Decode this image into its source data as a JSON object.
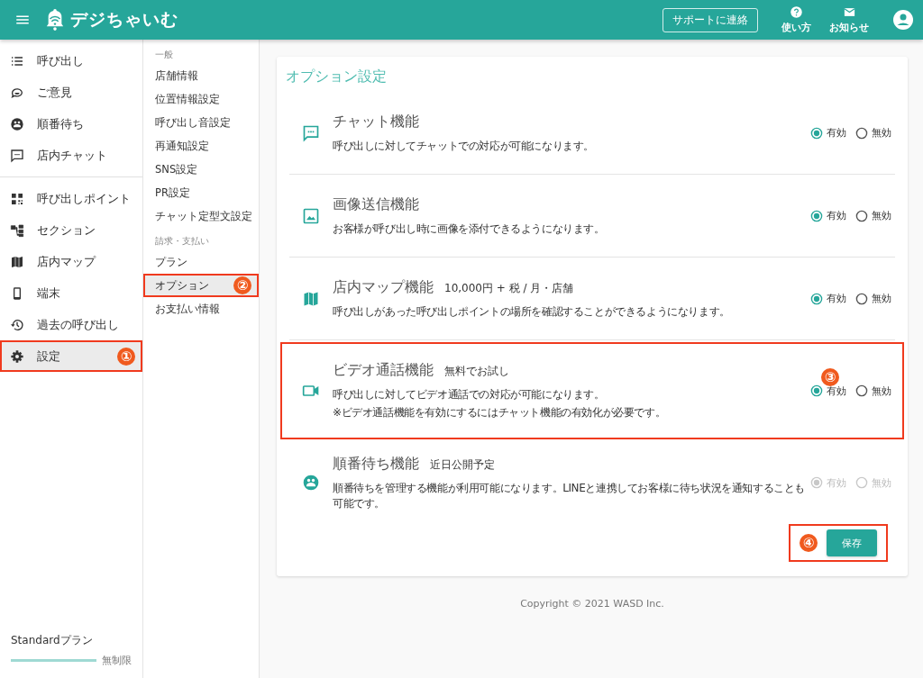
{
  "header": {
    "logo": "デジちゃいむ",
    "support_button": "サポートに連絡",
    "help": "使い方",
    "notices": "お知らせ"
  },
  "nav": {
    "groups": [
      [
        {
          "label": "呼び出し",
          "selected": false
        },
        {
          "label": "ご意見",
          "selected": false
        },
        {
          "label": "順番待ち",
          "selected": false
        },
        {
          "label": "店内チャット",
          "selected": false
        }
      ],
      [
        {
          "label": "呼び出しポイント",
          "selected": false
        },
        {
          "label": "セクション",
          "selected": false
        },
        {
          "label": "店内マップ",
          "selected": false
        },
        {
          "label": "端末",
          "selected": false
        },
        {
          "label": "過去の呼び出し",
          "selected": false
        },
        {
          "label": "設定",
          "selected": true,
          "callout": "①"
        }
      ]
    ],
    "plan": {
      "name": "Standardプラン",
      "level": 1,
      "reading": "無制限"
    }
  },
  "sub_nav": [
    {
      "heading": "一般",
      "items": [
        {
          "label": "店舗情報",
          "selected": false
        },
        {
          "label": "位置情報設定",
          "selected": false
        },
        {
          "label": "呼び出し音設定",
          "selected": false
        },
        {
          "label": "再通知設定",
          "selected": false
        },
        {
          "label": "SNS設定",
          "selected": false
        },
        {
          "label": "PR設定",
          "selected": false
        },
        {
          "label": "チャット定型文設定",
          "selected": false
        }
      ]
    },
    {
      "heading": "請求・支払い",
      "items": [
        {
          "label": "プラン",
          "selected": false
        },
        {
          "label": "オプション",
          "selected": true,
          "callout": "②"
        },
        {
          "label": "お支払い情報",
          "selected": false
        }
      ]
    }
  ],
  "options": {
    "title": "オプション設定",
    "items": [
      {
        "title": "チャット機能",
        "description": [
          "呼び出しに対してチャットでの対応が可能になります。"
        ],
        "disabled": false,
        "choices": [
          {
            "label": "有効",
            "selected": true
          },
          {
            "label": "無効",
            "selected": false
          }
        ]
      },
      {
        "title": "画像送信機能",
        "description": [
          "お客様が呼び出し時に画像を添付できるようになります。"
        ],
        "disabled": false,
        "choices": [
          {
            "label": "有効",
            "selected": true
          },
          {
            "label": "無効",
            "selected": false
          }
        ]
      },
      {
        "title": "店内マップ機能",
        "note": "10,000円 + 税 / 月・店舗",
        "description": [
          "呼び出しがあった呼び出しポイントの場所を確認することができるようになります。"
        ],
        "disabled": false,
        "choices": [
          {
            "label": "有効",
            "selected": true
          },
          {
            "label": "無効",
            "selected": false
          }
        ]
      },
      {
        "title": "ビデオ通話機能",
        "note": "無料でお試し",
        "description": [
          "呼び出しに対してビデオ通話での対応が可能になります。",
          "※ビデオ通話機能を有効にするにはチャット機能の有効化が必要です。"
        ],
        "disabled": false,
        "callout": "③",
        "choices": [
          {
            "label": "有効",
            "selected": true
          },
          {
            "label": "無効",
            "selected": false
          }
        ]
      },
      {
        "title": "順番待ち機能",
        "note": "近日公開予定",
        "description": [
          "順番待ちを管理する機能が利用可能になります。LINEと連携してお客様に待ち状況を通知することも可能です。"
        ],
        "disabled": true,
        "choices": [
          {
            "label": "有効",
            "selected": true
          },
          {
            "label": "無効",
            "selected": false
          }
        ]
      }
    ],
    "save_button": {
      "label": "保存",
      "callout": "④"
    }
  },
  "copyright": "Copyright © 2021 WASD Inc."
}
